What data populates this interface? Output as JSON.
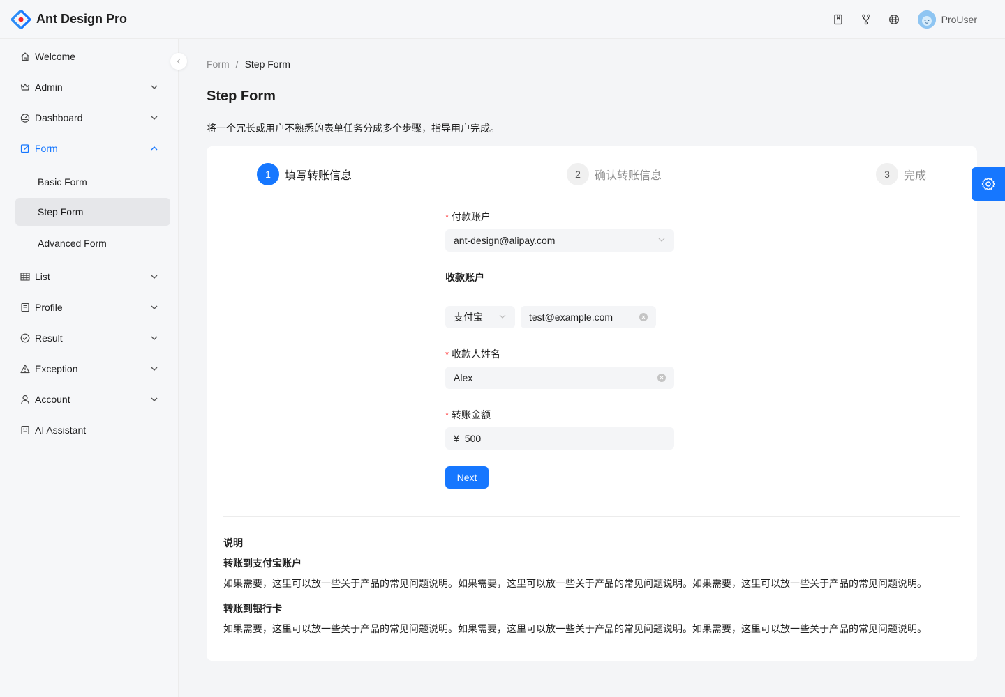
{
  "app": {
    "title": "Ant Design Pro"
  },
  "user": {
    "name": "ProUser"
  },
  "sidebar": {
    "items": [
      {
        "label": "Welcome",
        "icon": "home-icon"
      },
      {
        "label": "Admin",
        "icon": "crown-icon"
      },
      {
        "label": "Dashboard",
        "icon": "dashboard-icon"
      },
      {
        "label": "Form",
        "icon": "form-icon"
      },
      {
        "label": "Basic Form"
      },
      {
        "label": "Step Form"
      },
      {
        "label": "Advanced Form"
      },
      {
        "label": "List",
        "icon": "table-icon"
      },
      {
        "label": "Profile",
        "icon": "profile-icon"
      },
      {
        "label": "Result",
        "icon": "check-circle-icon"
      },
      {
        "label": "Exception",
        "icon": "warning-icon"
      },
      {
        "label": "Account",
        "icon": "user-icon"
      },
      {
        "label": "AI Assistant",
        "icon": "robot-icon"
      }
    ]
  },
  "breadcrumb": {
    "parent": "Form",
    "separator": "/",
    "current": "Step Form"
  },
  "page": {
    "title": "Step Form",
    "description": "将一个冗长或用户不熟悉的表单任务分成多个步骤，指导用户完成。"
  },
  "steps": [
    {
      "number": "1",
      "title": "填写转账信息",
      "status": "active"
    },
    {
      "number": "2",
      "title": "确认转账信息",
      "status": "wait"
    },
    {
      "number": "3",
      "title": "完成",
      "status": "wait"
    }
  ],
  "form": {
    "payer_label": "付款账户",
    "payer_value": "ant-design@alipay.com",
    "receiver_label": "收款账户",
    "receiver_type": "支付宝",
    "receiver_account": "test@example.com",
    "receiver_name_label": "收款人姓名",
    "receiver_name": "Alex",
    "amount_label": "转账金额",
    "amount_prefix": "¥",
    "amount": "500",
    "next_label": "Next"
  },
  "notes": {
    "title": "说明",
    "alipay_title": "转账到支付宝账户",
    "alipay_text": "如果需要，这里可以放一些关于产品的常见问题说明。如果需要，这里可以放一些关于产品的常见问题说明。如果需要，这里可以放一些关于产品的常见问题说明。",
    "bank_title": "转账到银行卡",
    "bank_text": "如果需要，这里可以放一些关于产品的常见问题说明。如果需要，这里可以放一些关于产品的常见问题说明。如果需要，这里可以放一些关于产品的常见问题说明。"
  },
  "colors": {
    "primary": "#1677ff",
    "required": "#ff4d4f"
  }
}
